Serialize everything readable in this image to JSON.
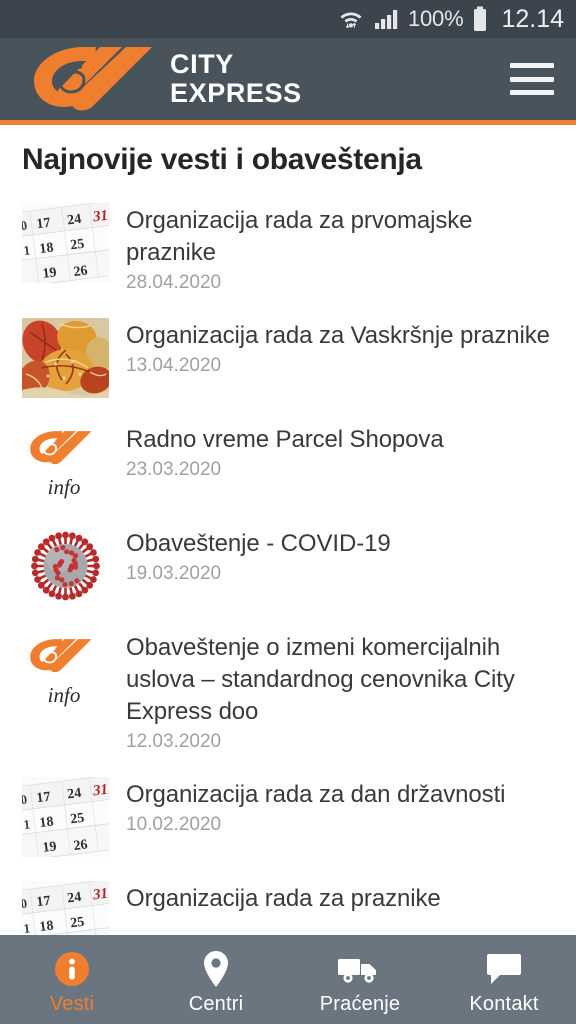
{
  "status_bar": {
    "wifi_icon": "wifi-icon",
    "signal_icon": "signal-bars-icon",
    "battery_percent": "100%",
    "battery_icon": "battery-full-icon",
    "clock": "12.14"
  },
  "header": {
    "logo_icon": "city-express-swoosh-logo",
    "brand_line1": "CITY",
    "brand_line2": "EXPRESS",
    "menu_icon": "hamburger-menu-icon",
    "bg_color": "#49535c",
    "accent_color": "#ef7f2f"
  },
  "main": {
    "page_title": "Najnovije vesti i obaveštenja",
    "news": [
      {
        "title": "Organizacija rada za prvomajske praznike",
        "date": "28.04.2020",
        "thumb": "calendar-dates-image"
      },
      {
        "title": "Organizacija rada za Vaskršnje praznike",
        "date": "13.04.2020",
        "thumb": "easter-eggs-image"
      },
      {
        "title": "Radno vreme Parcel Shopova",
        "date": "23.03.2020",
        "thumb": "city-express-info-logo"
      },
      {
        "title": "Obaveštenje - COVID-19",
        "date": "19.03.2020",
        "thumb": "coronavirus-image"
      },
      {
        "title": "Obaveštenje o izmeni komercijalnih uslova – standardnog cenovnika City Express doo",
        "date": "12.03.2020",
        "thumb": "city-express-info-logo"
      },
      {
        "title": "Organizacija rada za dan državnosti",
        "date": "10.02.2020",
        "thumb": "calendar-dates-image"
      },
      {
        "title": "Organizacija rada za praznike",
        "date": "",
        "thumb": "calendar-dates-image"
      }
    ]
  },
  "bottom_nav": {
    "items": [
      {
        "label": "Vesti",
        "icon": "info-circle-icon",
        "active": true
      },
      {
        "label": "Centri",
        "icon": "map-pin-icon",
        "active": false
      },
      {
        "label": "Praćenje",
        "icon": "truck-icon",
        "active": false
      },
      {
        "label": "Kontakt",
        "icon": "chat-bubble-icon",
        "active": false
      }
    ],
    "bg_color": "#6a757f",
    "active_color": "#ef7f2f"
  }
}
